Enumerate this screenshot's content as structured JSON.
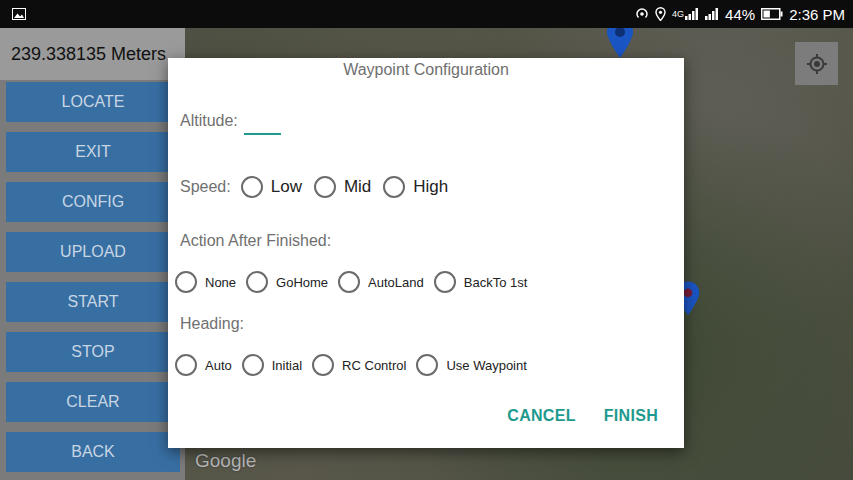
{
  "status_bar": {
    "network": "4G",
    "battery": {
      "text": "44%",
      "level": 0.44
    },
    "time": "2:36 PM"
  },
  "distance": "239.338135 Meters",
  "sidebar": {
    "buttons": [
      "LOCATE",
      "EXIT",
      "CONFIG",
      "UPLOAD",
      "START",
      "STOP",
      "CLEAR",
      "BACK"
    ]
  },
  "map": {
    "attribution": "Google"
  },
  "dialog": {
    "title": "Waypoint Configuration",
    "altitude": {
      "label": "Altitude:",
      "value": ""
    },
    "speed": {
      "label": "Speed:",
      "options": [
        {
          "label": "Low",
          "selected": false
        },
        {
          "label": "Mid",
          "selected": false
        },
        {
          "label": "High",
          "selected": false
        }
      ]
    },
    "action_after_finished": {
      "label": "Action After Finished:",
      "options": [
        {
          "label": "None",
          "selected": false
        },
        {
          "label": "GoHome",
          "selected": false
        },
        {
          "label": "AutoLand",
          "selected": false
        },
        {
          "label": "BackTo 1st",
          "selected": false
        }
      ]
    },
    "heading": {
      "label": "Heading:",
      "options": [
        {
          "label": "Auto",
          "selected": false
        },
        {
          "label": "Initial",
          "selected": false
        },
        {
          "label": "RC Control",
          "selected": false
        },
        {
          "label": "Use Waypoint",
          "selected": false
        }
      ]
    },
    "buttons": [
      "CANCEL",
      "FINISH"
    ]
  }
}
